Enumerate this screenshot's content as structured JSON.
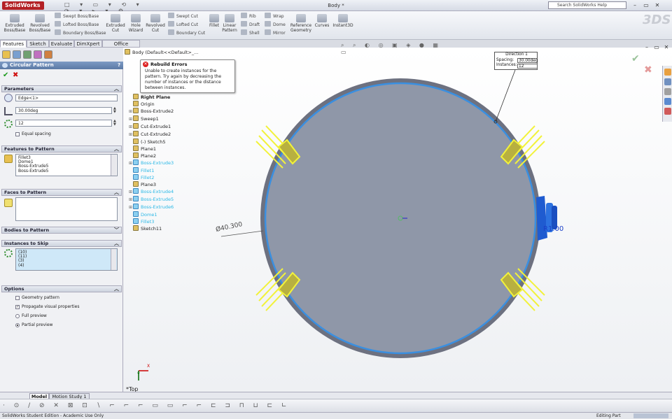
{
  "app": {
    "logo": "SolidWorks",
    "document_title": "Body *",
    "search_placeholder": "Search SolidWorks Help"
  },
  "ribbon": {
    "large": [
      {
        "id": "extruded-boss",
        "label": "Extruded\nBoss/Base"
      },
      {
        "id": "revolved-boss",
        "label": "Revolved\nBoss/Base"
      },
      {
        "id": "extruded-cut",
        "label": "Extruded\nCut"
      },
      {
        "id": "hole-wizard",
        "label": "Hole\nWizard"
      },
      {
        "id": "revolved-cut",
        "label": "Revolved\nCut"
      },
      {
        "id": "fillet",
        "label": "Fillet"
      },
      {
        "id": "linear-pattern",
        "label": "Linear\nPattern"
      },
      {
        "id": "reference-geometry",
        "label": "Reference\nGeometry"
      },
      {
        "id": "curves",
        "label": "Curves"
      },
      {
        "id": "instant3d",
        "label": "Instant3D"
      }
    ],
    "small": {
      "swept_boss": "Swept Boss/Base",
      "lofted_boss": "Lofted Boss/Base",
      "boundary_boss": "Boundary Boss/Base",
      "swept_cut": "Swept Cut",
      "lofted_cut": "Lofted Cut",
      "boundary_cut": "Boundary Cut",
      "rib": "Rib",
      "draft": "Draft",
      "shell": "Shell",
      "wrap": "Wrap",
      "dome": "Dome",
      "mirror": "Mirror"
    }
  },
  "tabs": [
    "Features",
    "Sketch",
    "Evaluate",
    "DimXpert",
    "Office Products"
  ],
  "property_manager": {
    "title": "Circular Pattern",
    "parameters": {
      "heading": "Parameters",
      "axis": "Edge<1>",
      "angle": "30.00deg",
      "instances": "12",
      "equal_spacing": "Equal spacing"
    },
    "features_to_pattern": {
      "heading": "Features to Pattern",
      "items": [
        "Fillet3",
        "Dome1",
        "Boss-Extrude5",
        "Boss-Extrude5"
      ]
    },
    "faces_to_pattern": {
      "heading": "Faces to Pattern"
    },
    "bodies_to_pattern": {
      "heading": "Bodies to Pattern"
    },
    "instances_to_skip": {
      "heading": "Instances to Skip",
      "items": [
        "(10)",
        "(11)",
        "(3)",
        "(4)"
      ]
    },
    "options": {
      "heading": "Options",
      "geometry_pattern": "Geometry pattern",
      "propagate": "Propagate visual properties",
      "full_preview": "Full preview",
      "partial_preview": "Partial preview"
    }
  },
  "feature_tree": {
    "root": "Body  (Default<<Default>_...",
    "items": [
      {
        "label": "Right Plane",
        "blue": false,
        "expand": false,
        "bold": true
      },
      {
        "label": "Origin",
        "blue": false,
        "expand": false
      },
      {
        "label": "Boss-Extrude2",
        "blue": false,
        "expand": true
      },
      {
        "label": "Sweep1",
        "blue": false,
        "expand": true
      },
      {
        "label": "Cut-Extrude1",
        "blue": false,
        "expand": true
      },
      {
        "label": "Cut-Extrude2",
        "blue": false,
        "expand": true
      },
      {
        "label": "(-) Sketch5",
        "blue": false,
        "expand": false
      },
      {
        "label": "Plane1",
        "blue": false,
        "expand": false
      },
      {
        "label": "Plane2",
        "blue": false,
        "expand": false
      },
      {
        "label": "Boss-Extrude3",
        "blue": true,
        "expand": true
      },
      {
        "label": "Fillet1",
        "blue": true,
        "expand": false
      },
      {
        "label": "Fillet2",
        "blue": true,
        "expand": false
      },
      {
        "label": "Plane3",
        "blue": false,
        "expand": false
      },
      {
        "label": "Boss-Extrude4",
        "blue": true,
        "expand": true
      },
      {
        "label": "Boss-Extrude5",
        "blue": true,
        "expand": true
      },
      {
        "label": "Boss-Extrude6",
        "blue": true,
        "expand": true
      },
      {
        "label": "Dome1",
        "blue": true,
        "expand": false
      },
      {
        "label": "Fillet3",
        "blue": true,
        "expand": false
      },
      {
        "label": "Sketch11",
        "blue": false,
        "expand": false
      }
    ]
  },
  "error_tooltip": {
    "title": "Rebuild Errors",
    "text": "Unable to create instances for the pattern. Try again by decreasing the number of instances or the distance between instances."
  },
  "callout": {
    "heading": "Direction 1",
    "spacing_label": "Spacing:",
    "spacing": "30.00deg",
    "instances_label": "Instances:",
    "instances": "12"
  },
  "dimensions": {
    "diameter": "Ø40.300",
    "radius": "R1.00"
  },
  "viewport": {
    "view_name": "*Top",
    "triad_x": "X",
    "triad_y": "Y"
  },
  "bottom_tabs": [
    "Model",
    "Motion Study 1"
  ],
  "status": {
    "left": "SolidWorks Student Edition - Academic Use Only",
    "right": "Editing Part"
  },
  "colors": {
    "pm_header": "#5b79a5",
    "highlight": "#2bb8e6",
    "preview": "#f2f23a",
    "body": "#8f97a8",
    "edge": "#3a8fe0"
  }
}
